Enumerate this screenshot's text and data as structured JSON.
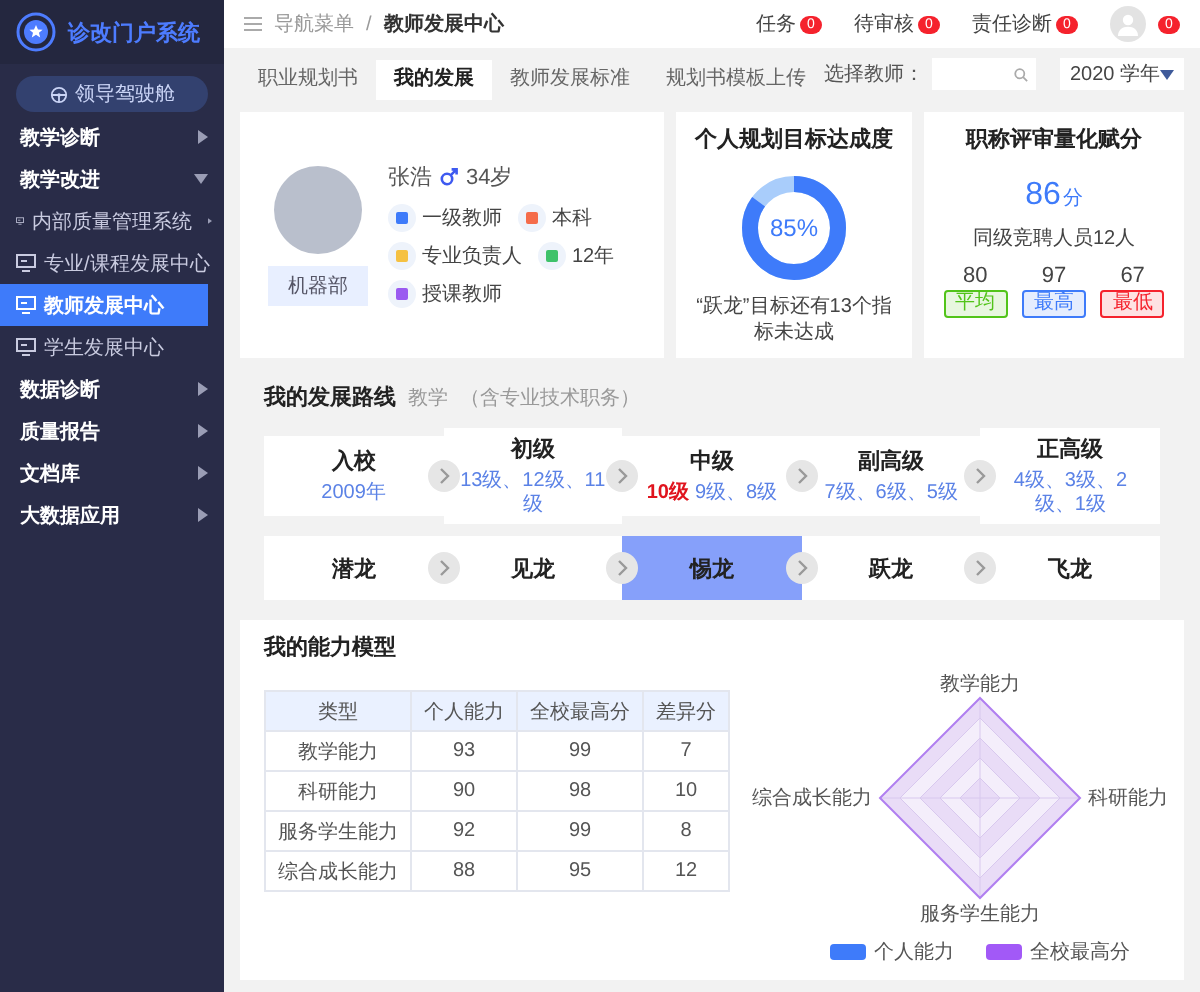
{
  "sidebar": {
    "logo": "诊改门户系统",
    "cockpit_button": "领导驾驶舱",
    "items": [
      {
        "label": "教学诊断",
        "expanded": false
      },
      {
        "label": "教学改进",
        "expanded": true,
        "children": [
          {
            "label": "内部质量管理系统",
            "kind": "folder",
            "selected": false
          },
          {
            "label": "专业/课程发展中心",
            "kind": "page",
            "selected": false
          },
          {
            "label": "教师发展中心",
            "kind": "page",
            "selected": true
          },
          {
            "label": "学生发展中心",
            "kind": "page",
            "selected": false
          }
        ]
      },
      {
        "label": "数据诊断",
        "expanded": false
      },
      {
        "label": "质量报告",
        "expanded": false
      },
      {
        "label": "文档库",
        "expanded": false
      },
      {
        "label": "大数据应用",
        "expanded": false
      }
    ]
  },
  "header": {
    "breadcrumb": [
      "导航菜单",
      "教师发展中心"
    ],
    "separator": "/",
    "notices": [
      {
        "label": "任务",
        "count": "0"
      },
      {
        "label": "待审核",
        "count": "0"
      },
      {
        "label": "责任诊断",
        "count": "0"
      }
    ],
    "avatar_count": "0"
  },
  "tabs": [
    {
      "label": "职业规划书",
      "selected": false
    },
    {
      "label": "我的发展",
      "selected": true
    },
    {
      "label": "教师发展标准",
      "selected": false
    },
    {
      "label": "规划书模板上传",
      "selected": false
    }
  ],
  "filter": {
    "label": "选择教师：",
    "year": "2020 学年"
  },
  "profile": {
    "name": "张浩",
    "male": true,
    "age": "34岁",
    "facts": [
      {
        "kind": "rank",
        "text": "一级教师"
      },
      {
        "kind": "degree",
        "text": "本科"
      },
      {
        "kind": "role",
        "text": "专业负责人"
      },
      {
        "kind": "years",
        "text": "12年"
      },
      {
        "kind": "duty",
        "text": "授课教师"
      }
    ],
    "department": "机器部"
  },
  "goal": {
    "title": "个人规划目标达成度",
    "level": 0.85,
    "value": "85%",
    "note": "“跃龙”目标还有13个指标未达成"
  },
  "score": {
    "title": "职称评审量化赋分",
    "value": "86",
    "unit": "分",
    "note": "同级竞聘人员12人",
    "stats": [
      {
        "value": "80",
        "label": "平均",
        "color": "#52c41a"
      },
      {
        "value": "97",
        "label": "最高",
        "color": "#3e7bfa"
      },
      {
        "value": "67",
        "label": "最低",
        "color": "#f5222d"
      }
    ]
  },
  "route": {
    "title": "我的发展路线",
    "subtitle": "教学",
    "note": "（含专业技术职务）",
    "levels": [
      {
        "label": "入校",
        "grades": "2009年"
      },
      {
        "label": "初级",
        "grades": "13级、12级、11级"
      },
      {
        "label": "中级",
        "current": "10级",
        "grades": "9级、8级"
      },
      {
        "label": "副高级",
        "grades": "7级、6级、5级"
      },
      {
        "label": "正高级",
        "grades": "4级、3级、2级、1级"
      }
    ],
    "stages": [
      {
        "label": "潜龙",
        "selected": false
      },
      {
        "label": "见龙",
        "selected": false
      },
      {
        "label": "惕龙",
        "selected": true
      },
      {
        "label": "跃龙",
        "selected": false
      },
      {
        "label": "飞龙",
        "selected": false
      }
    ]
  },
  "ability": {
    "title": "我的能力模型",
    "table": {
      "columns": [
        "类型",
        "个人能力",
        "全校最高分",
        "差异分"
      ],
      "rows": [
        [
          "教学能力",
          "93",
          "99",
          "7"
        ],
        [
          "科研能力",
          "90",
          "98",
          "10"
        ],
        [
          "服务学生能力",
          "92",
          "99",
          "8"
        ],
        [
          "综合成长能力",
          "88",
          "95",
          "12"
        ]
      ]
    },
    "radar_axes": [
      "教学能力",
      "科研能力",
      "服务学生能力",
      "综合成长能力"
    ],
    "legend": [
      {
        "label": "个人能力",
        "color": "#3e7bfa"
      },
      {
        "label": "全校最高分",
        "color": "#a259f7"
      }
    ]
  }
}
